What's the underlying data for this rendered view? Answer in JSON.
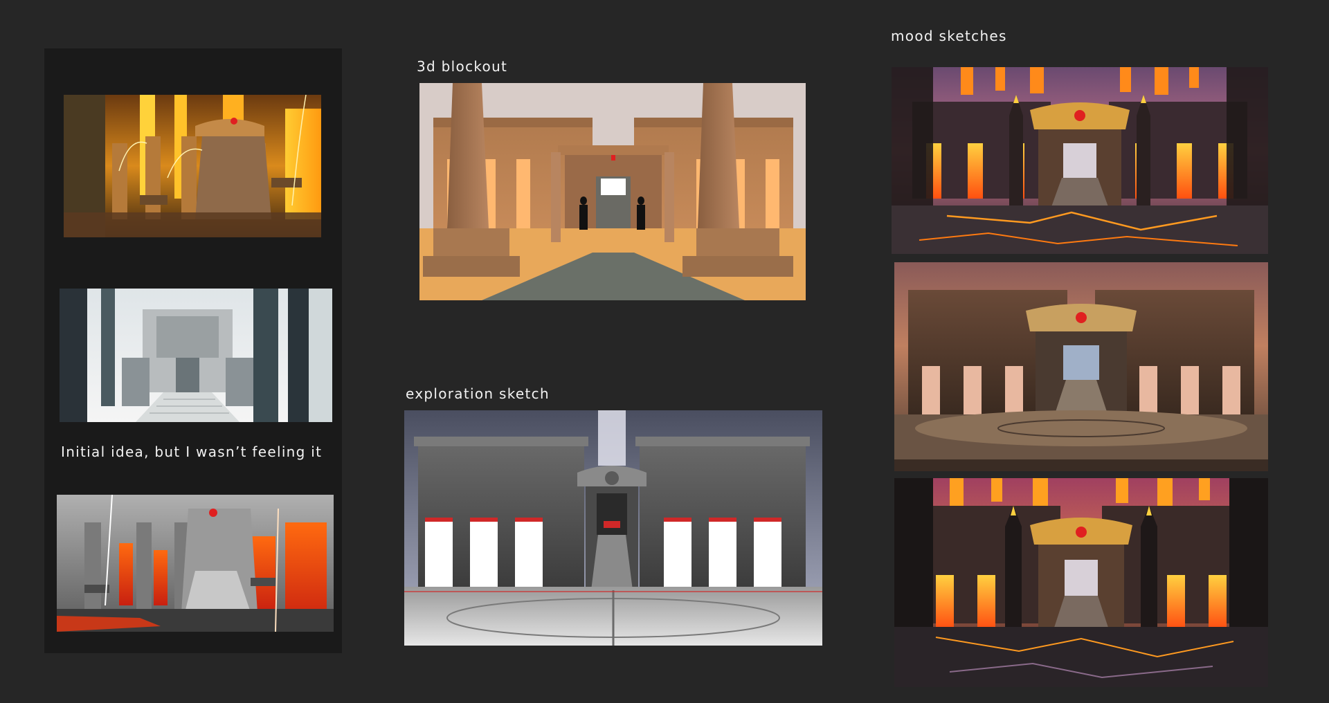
{
  "labels": {
    "blockout": "3d blockout",
    "exploration": "exploration sketch",
    "mood": "mood sketches",
    "initial": "Initial idea, but I wasn’t feeling it"
  },
  "images": [
    {
      "id": "initial-lava-temple",
      "subject": "golden lava temple interior with waterfalls and braziers"
    },
    {
      "id": "initial-gray-temple",
      "subject": "desaturated gray temple entrance with stairs"
    },
    {
      "id": "initial-gray-lava-hall",
      "subject": "gray hall with lava windows and light streams"
    },
    {
      "id": "blockout-render",
      "subject": "3d blockout of temple facade with obelisks, pathway and two figures"
    },
    {
      "id": "exploration-render",
      "subject": "stone temple facade with glowing doorways"
    },
    {
      "id": "mood-sketch-1",
      "subject": "dark temple with lava, obelisks and red gem gate"
    },
    {
      "id": "mood-sketch-2",
      "subject": "brown temple facade with ornate gate"
    },
    {
      "id": "mood-sketch-3",
      "subject": "lava temple gate with obelisks, darker mood"
    }
  ],
  "colors": {
    "background": "#262626",
    "panel": "#1a1a1a",
    "text": "#f2f2f2",
    "lava": "#ff8a1a",
    "gem": "#e02020"
  }
}
